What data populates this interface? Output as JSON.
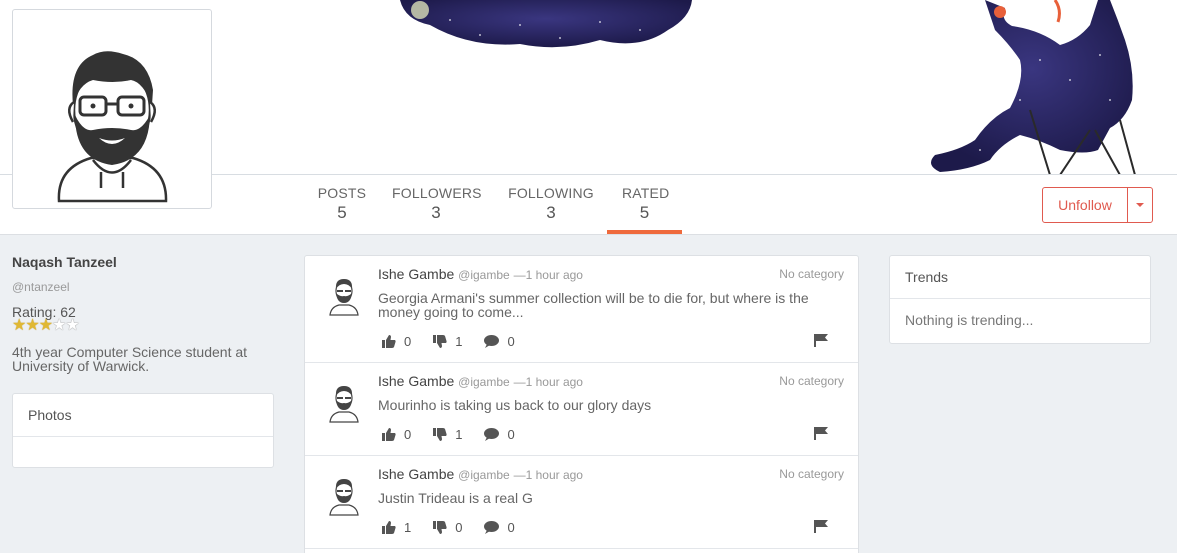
{
  "profile": {
    "name": "Naqash Tanzeel",
    "handle": "@ntanzeel",
    "rating_label": "Rating: 62",
    "stars": 3,
    "stars_max": 5,
    "bio": "4th year Computer Science student at University of Warwick."
  },
  "stats": [
    {
      "label": "POSTS",
      "value": "5"
    },
    {
      "label": "FOLLOWERS",
      "value": "3"
    },
    {
      "label": "FOLLOWING",
      "value": "3"
    },
    {
      "label": "RATED",
      "value": "5"
    }
  ],
  "active_tab": "RATED",
  "actions": {
    "unfollow_label": "Unfollow"
  },
  "photos_panel": {
    "title": "Photos"
  },
  "trends_panel": {
    "title": "Trends",
    "empty_text": "Nothing is trending..."
  },
  "posts": [
    {
      "author": "Ishe Gambe",
      "handle": "@igambe",
      "time": "—1 hour ago",
      "category": "No category",
      "text": "Georgia Armani's summer collection will be to die for, but where is the money going to come...",
      "likes": "0",
      "dislikes": "1",
      "comments": "0"
    },
    {
      "author": "Ishe Gambe",
      "handle": "@igambe",
      "time": "—1 hour ago",
      "category": "No category",
      "text": "Mourinho is taking us back to our glory days",
      "likes": "0",
      "dislikes": "1",
      "comments": "0"
    },
    {
      "author": "Ishe Gambe",
      "handle": "@igambe",
      "time": "—1 hour ago",
      "category": "No category",
      "text": "Justin Trideau is a real G",
      "likes": "1",
      "dislikes": "0",
      "comments": "0"
    }
  ],
  "colors": {
    "accent": "#ef6a3c",
    "danger": "#e05a4f",
    "star": "#e0b833"
  }
}
